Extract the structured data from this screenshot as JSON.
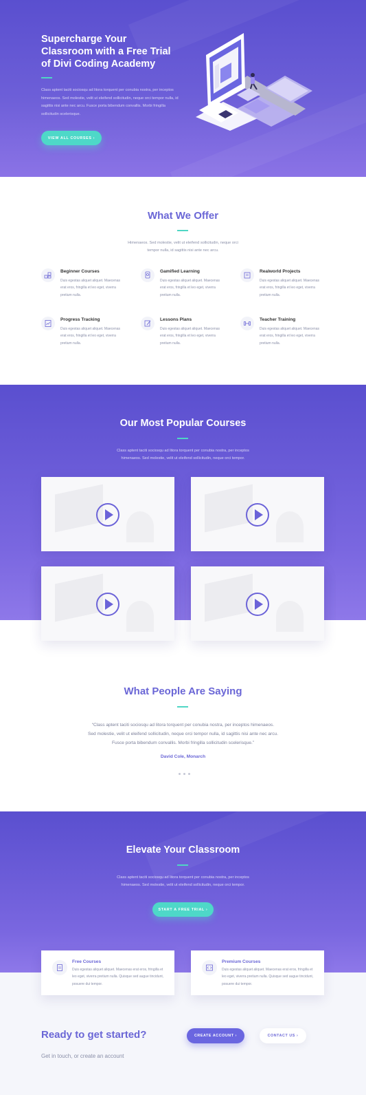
{
  "hero": {
    "title": "Supercharge Your Classroom with a Free Trial of Divi Coding Academy",
    "text": "Class aptent taciti sociosqu ad litora torquent per conubia nostra, per inceptos himenaeos. Sed molestie, velit ut eleifend sollicitudin, neque orci tempor nulla, id sagittis nisi ante nec arcu. Fusce porta bibendum convallis. Morbi fringilla sollicitudin scelerisque.",
    "button": "VIEW ALL COURSES ›"
  },
  "offer": {
    "title": "What We Offer",
    "text_line1": "Himenaeos. Sed molestie, velit ut eleifend sollicitudin, neque orci",
    "text_line2": "tempor nulla, id sagittis nisi ante nec arcu.",
    "features": [
      {
        "title": "Beginner Courses",
        "desc": "Duis egestas aliquet aliquet. Maecenas erat eros, fringilla et leo eget, viverra pretium nulla.",
        "icon": "blocks-icon"
      },
      {
        "title": "Gamified Learning",
        "desc": "Duis egestas aliquet aliquet. Maecenas erat eros, fringilla et leo eget, viverra pretium nulla.",
        "icon": "badge-icon"
      },
      {
        "title": "Realworld Projects",
        "desc": "Duis egestas aliquet aliquet. Maecenas erat eros, fringilla et leo eget, viverra pretium nulla.",
        "icon": "document-icon"
      },
      {
        "title": "Progress Tracking",
        "desc": "Duis egestas aliquet aliquet. Maecenas erat eros, fringilla et leo eget, viverra pretium nulla.",
        "icon": "chart-icon"
      },
      {
        "title": "Lessons Plans",
        "desc": "Duis egestas aliquet aliquet. Maecenas erat eros, fringilla et leo eget, viverra pretium nulla.",
        "icon": "pencil-icon"
      },
      {
        "title": "Teacher Training",
        "desc": "Duis egestas aliquet aliquet. Maecenas erat eros, fringilla et leo eget, viverra pretium nulla.",
        "icon": "dumbbell-icon"
      }
    ]
  },
  "courses": {
    "title": "Our Most Popular Courses",
    "text_line1": "Class aptent taciti sociosqu ad litora torquent per conubia nostra, per inceptos",
    "text_line2": "himenaeos. Sed molestie, velit ut eleifend sollicitudin, neque orci tempor."
  },
  "testimonial": {
    "title": "What People Are Saying",
    "quote_line1": "“Class aptent taciti sociosqu ad litora torquent per conubia nostra, per inceptos himenaeos.",
    "quote_line2": "Sed molestie, velit ut eleifend sollicitudin, neque orci tempor nulla, id sagittis nisi ante nec arcu.",
    "quote_line3": "Fusce porta bibendum convallis. Morbi fringilla sollicitudin scelerisque.”",
    "author": "David Cole, Monarch"
  },
  "elevate": {
    "title": "Elevate Your Classroom",
    "text_line1": "Class aptent taciti sociosqu ad litora torquent per conubia nostra, per inceptos",
    "text_line2": "himenaeos. Sed molestie, velit ut eleifend sollicitudin, neque orci tempor.",
    "button": "START A FREE TRIAL ›"
  },
  "cards": [
    {
      "title": "Free Courses",
      "desc": "Duis egestas aliquet aliquet. Maecenas erat eros, fringilla et leo eget, viverra pretium nulla. Quisque sed augue tincidunt, posuere dui tempor."
    },
    {
      "title": "Premium Courses",
      "desc": "Duis egestas aliquet aliquet. Maecenas erat eros, fringilla et leo eget, viverra pretium nulla. Quisque sed augue tincidunt, posuere dui tempor."
    }
  ],
  "cta": {
    "title": "Ready to get started?",
    "subtitle": "Get in touch, or create an account",
    "create_button": "CREATE ACCOUNT ›",
    "contact_button": "CONTACT US ›"
  },
  "colors": {
    "purple": "#5a4fcf",
    "accent_purple": "#6a66d6",
    "teal": "#4ed8c8"
  }
}
